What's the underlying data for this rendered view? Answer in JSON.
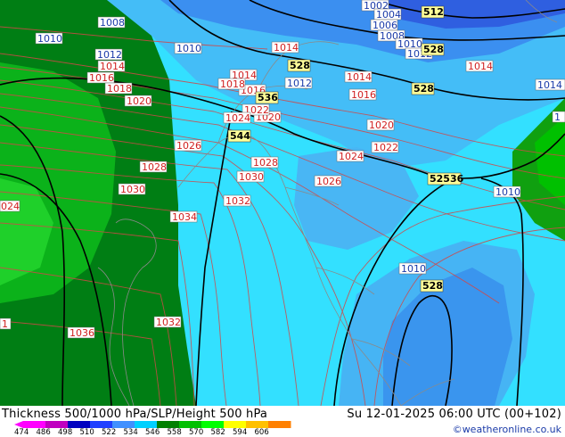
{
  "footer": {
    "title": "Thickness 500/1000 hPa/SLP/Height 500 hPa",
    "time": "Su 12-01-2025 06:00 UTC (00+102)",
    "credit": "©weatheronline.co.uk"
  },
  "colorbar": {
    "ticks": [
      "474",
      "486",
      "498",
      "510",
      "522",
      "534",
      "546",
      "558",
      "570",
      "582",
      "594",
      "606"
    ],
    "colors": [
      "#ff00ff",
      "#c000c0",
      "#0000c0",
      "#2040ff",
      "#4090ff",
      "#00d0ff",
      "#008000",
      "#00c000",
      "#00ff00",
      "#ffff00",
      "#ffc000",
      "#ff8000"
    ]
  },
  "isobar_labels": [
    {
      "text": "1002"
    },
    {
      "text": "1004"
    },
    {
      "text": "1006"
    },
    {
      "text": "1008"
    },
    {
      "text": "1008"
    },
    {
      "text": "1010"
    },
    {
      "text": "1010"
    },
    {
      "text": "1010"
    },
    {
      "text": "1010"
    },
    {
      "text": "1010"
    },
    {
      "text": "1012"
    },
    {
      "text": "1012"
    },
    {
      "text": "1012"
    },
    {
      "text": "1014"
    },
    {
      "text": "1014"
    },
    {
      "text": "1014"
    },
    {
      "text": "1014"
    },
    {
      "text": "1014"
    },
    {
      "text": "1016"
    },
    {
      "text": "1016"
    },
    {
      "text": "1016"
    },
    {
      "text": "1018"
    },
    {
      "text": "1018"
    },
    {
      "text": "1020"
    },
    {
      "text": "1020"
    },
    {
      "text": "1020"
    },
    {
      "text": "1022"
    },
    {
      "text": "1022"
    },
    {
      "text": "1024"
    },
    {
      "text": "1024"
    },
    {
      "text": "1026"
    },
    {
      "text": "1026"
    },
    {
      "text": "1028"
    },
    {
      "text": "1028"
    },
    {
      "text": "1030"
    },
    {
      "text": "1030"
    },
    {
      "text": "1032"
    },
    {
      "text": "1034"
    },
    {
      "text": "1036"
    },
    {
      "text": "1032"
    },
    {
      "text": "1014"
    },
    {
      "text": "1010"
    },
    {
      "text": "1010"
    },
    {
      "text": "1012"
    },
    {
      "text": "1018"
    },
    {
      "text": "1016"
    },
    {
      "text": "1022"
    },
    {
      "text": "1012"
    },
    {
      "text": "024"
    },
    {
      "text": "1"
    },
    {
      "text": "1"
    },
    {
      "text": "1016"
    }
  ],
  "height_labels": [
    {
      "text": "512"
    },
    {
      "text": "528"
    },
    {
      "text": "528"
    },
    {
      "text": "528"
    },
    {
      "text": "536"
    },
    {
      "text": "544"
    },
    {
      "text": "52536"
    },
    {
      "text": "528"
    }
  ]
}
